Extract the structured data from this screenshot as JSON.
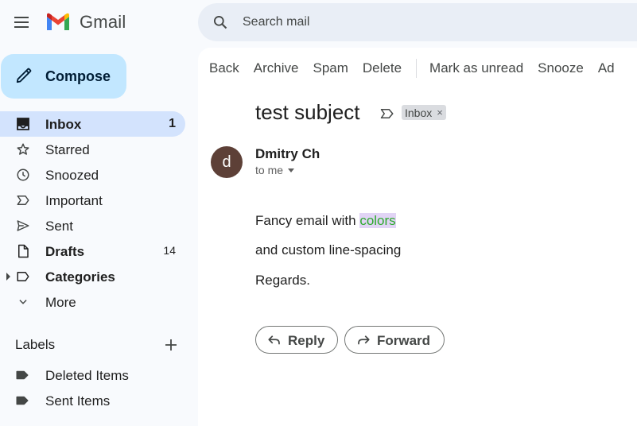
{
  "app": {
    "name": "Gmail"
  },
  "compose": {
    "label": "Compose"
  },
  "sidebar": {
    "items": [
      {
        "label": "Inbox",
        "count": "1",
        "icon": "inbox-icon"
      },
      {
        "label": "Starred",
        "count": "",
        "icon": "star-icon"
      },
      {
        "label": "Snoozed",
        "count": "",
        "icon": "clock-icon"
      },
      {
        "label": "Important",
        "count": "",
        "icon": "important-icon"
      },
      {
        "label": "Sent",
        "count": "",
        "icon": "send-icon"
      },
      {
        "label": "Drafts",
        "count": "14",
        "icon": "draft-icon"
      },
      {
        "label": "Categories",
        "count": "",
        "icon": "label-icon"
      },
      {
        "label": "More",
        "count": "",
        "icon": "chevron-down-icon"
      }
    ],
    "labels_heading": "Labels",
    "labels": [
      {
        "label": "Deleted Items",
        "icon": "label-filled-icon"
      },
      {
        "label": "Sent Items",
        "icon": "label-filled-icon"
      }
    ]
  },
  "search": {
    "placeholder": "Search mail"
  },
  "toolbar": {
    "back": "Back",
    "archive": "Archive",
    "spam": "Spam",
    "delete": "Delete",
    "mark_unread": "Mark as unread",
    "snooze": "Snooze",
    "add_to_tasks": "Ad"
  },
  "message": {
    "subject": "test subject",
    "chip": "Inbox",
    "chip_close": "×",
    "avatar_letter": "d",
    "sender": "Dmitry Ch",
    "recipient": "to me",
    "body": {
      "line1_prefix": "Fancy email with ",
      "line1_highlight": "colors",
      "line2": "and custom line-spacing",
      "line3": "Regards."
    },
    "reply_label": "Reply",
    "forward_label": "Forward"
  },
  "colors": {
    "compose_bg": "#c2e7ff",
    "active_nav_bg": "#d3e3fd",
    "search_bg": "#e9eef6",
    "avatar_bg": "#5d4037",
    "highlight_text": "#2eaa2e",
    "highlight_bg": "#e1d4f5"
  }
}
